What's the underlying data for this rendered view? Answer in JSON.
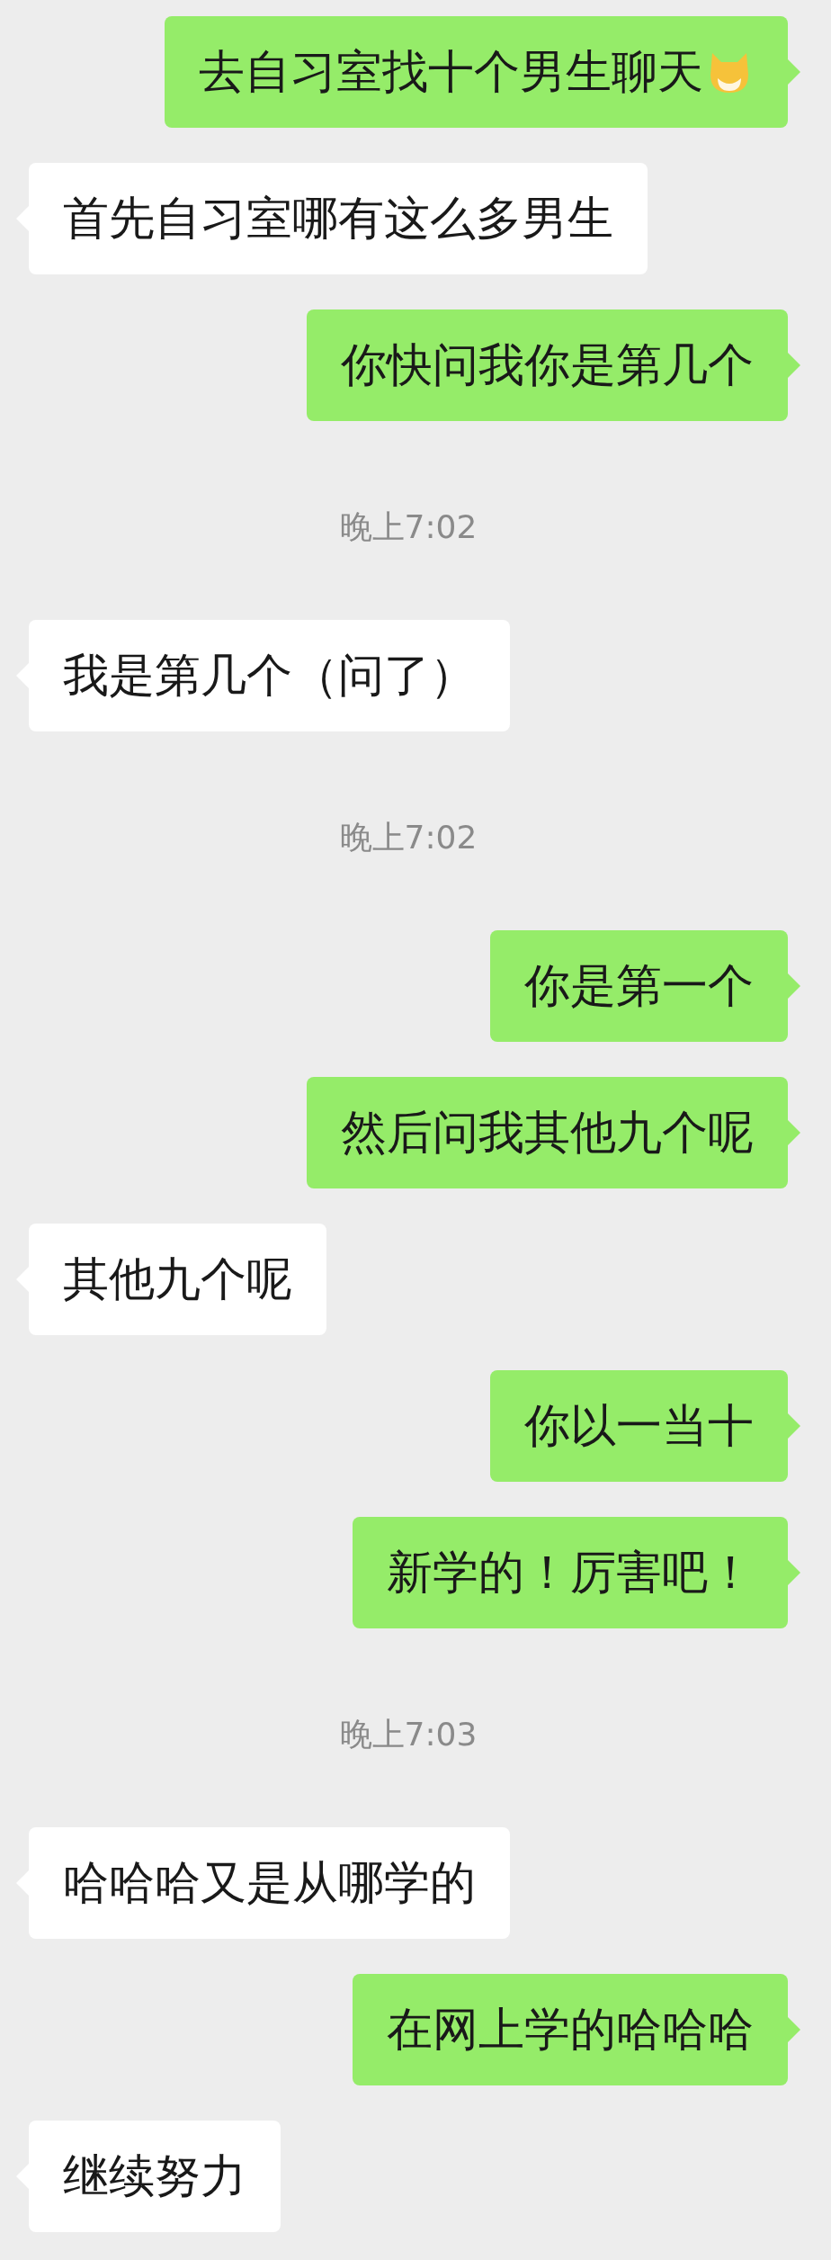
{
  "messages": [
    {
      "kind": "sent",
      "text": "去自习室找十个男生聊天",
      "emoji": true
    },
    {
      "kind": "received",
      "text": "首先自习室哪有这么多男生",
      "emoji": false
    },
    {
      "kind": "sent",
      "text": "你快问我你是第几个",
      "emoji": false
    },
    {
      "kind": "timestamp",
      "text": "晚上7:02"
    },
    {
      "kind": "received",
      "text": "我是第几个（问了）",
      "emoji": false
    },
    {
      "kind": "timestamp",
      "text": "晚上7:02"
    },
    {
      "kind": "sent",
      "text": "你是第一个",
      "emoji": false
    },
    {
      "kind": "sent",
      "text": "然后问我其他九个呢",
      "emoji": false
    },
    {
      "kind": "received",
      "text": "其他九个呢",
      "emoji": false
    },
    {
      "kind": "sent",
      "text": "你以一当十",
      "emoji": false
    },
    {
      "kind": "sent",
      "text": "新学的！厉害吧！",
      "emoji": false
    },
    {
      "kind": "timestamp",
      "text": "晚上7:03"
    },
    {
      "kind": "received",
      "text": "哈哈哈又是从哪学的",
      "emoji": false
    },
    {
      "kind": "sent",
      "text": "在网上学的哈哈哈",
      "emoji": false
    },
    {
      "kind": "received",
      "text": "继续努力",
      "emoji": false
    }
  ]
}
